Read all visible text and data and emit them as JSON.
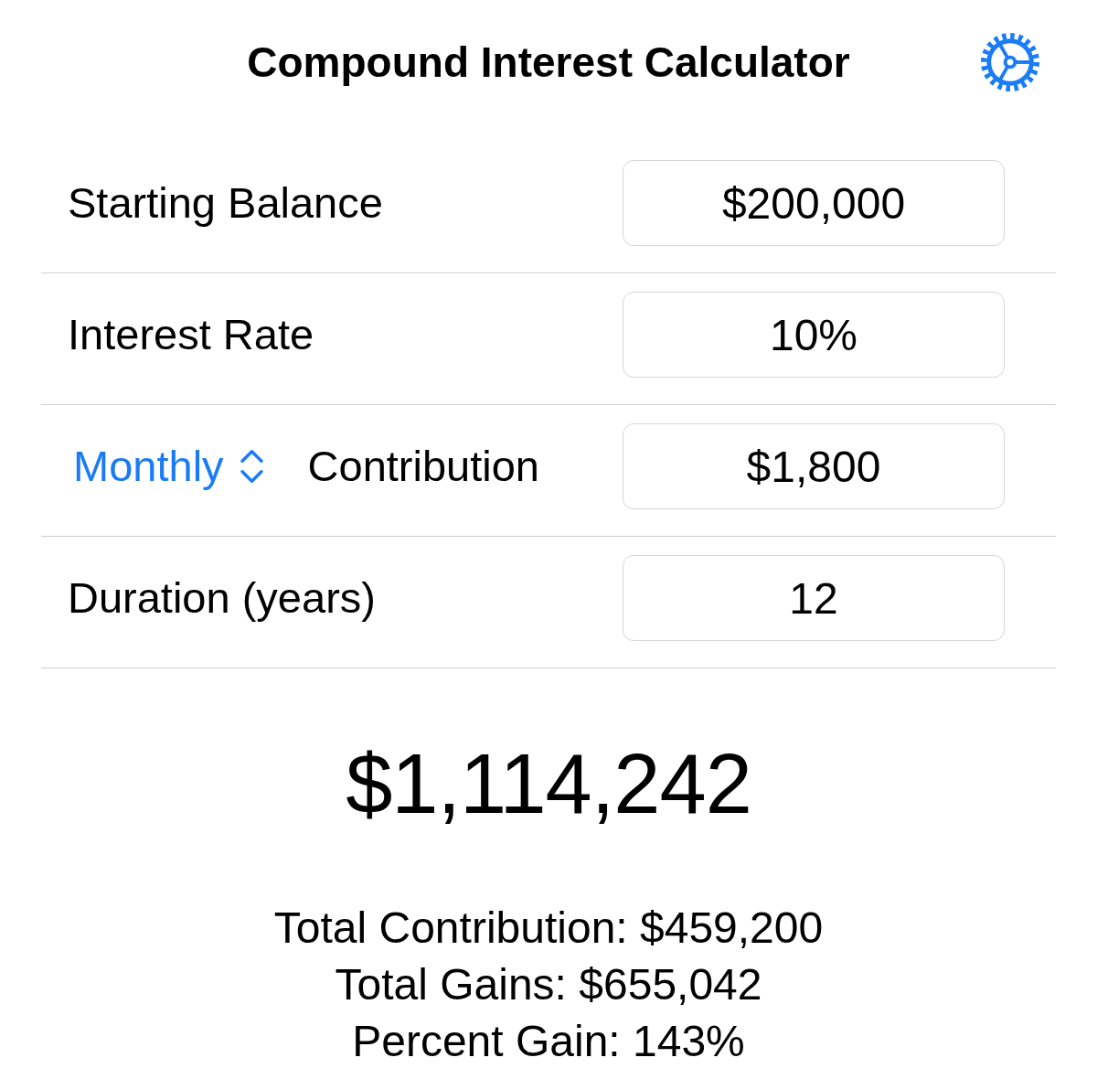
{
  "title": "Compound Interest Calculator",
  "rows": [
    {
      "kind": "input",
      "label": "Starting Balance",
      "value": "$200,000"
    },
    {
      "kind": "input",
      "label": "Interest Rate",
      "value": "10%"
    },
    {
      "kind": "picker",
      "picker": "Monthly",
      "label": "Contribution",
      "value": "$1,800"
    },
    {
      "kind": "input",
      "label": "Duration (years)",
      "value": "12"
    }
  ],
  "result": "$1,114,242",
  "summary": [
    "Total Contribution: $459,200",
    "Total Gains: $655,042",
    "Percent Gain: 143%"
  ]
}
